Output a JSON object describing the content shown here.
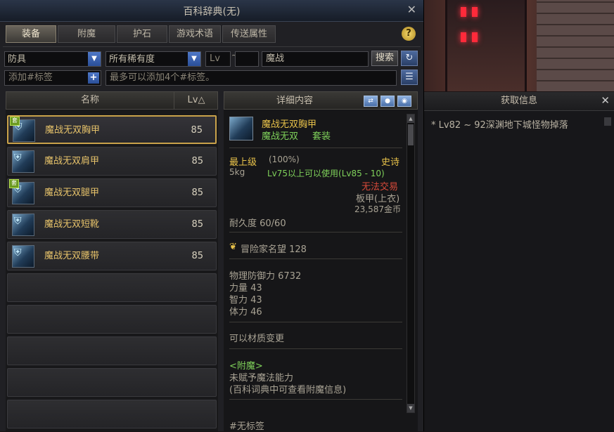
{
  "window": {
    "title": "百科辞典(无)",
    "close": "✕"
  },
  "tabs": [
    {
      "label": "装备",
      "active": true
    },
    {
      "label": "附魔",
      "active": false
    },
    {
      "label": "护石",
      "active": false
    },
    {
      "label": "游戏术语",
      "active": false
    },
    {
      "label": "传送属性",
      "active": false
    }
  ],
  "help": "?",
  "filters": {
    "category": "防具",
    "rarity": "所有稀有度",
    "lv_label": "Lv",
    "lv_sep": "~",
    "lv_min": "",
    "lv_max": "",
    "search_value": "魔战",
    "search_button": "搜索",
    "refresh_icon": "↻",
    "tag_placeholder": "添加#标签",
    "tag_add": "+",
    "tag_hint": "最多可以添加4个#标签。",
    "sort_icon": "☰"
  },
  "list": {
    "col_name": "名称",
    "col_lv": "Lv△",
    "items": [
      {
        "name": "魔战无双胸甲",
        "lv": "85",
        "selected": true
      },
      {
        "name": "魔战无双肩甲",
        "lv": "85",
        "selected": false
      },
      {
        "name": "魔战无双腿甲",
        "lv": "85",
        "selected": false
      },
      {
        "name": "魔战无双短靴",
        "lv": "85",
        "selected": false
      },
      {
        "name": "魔战无双腰带",
        "lv": "85",
        "selected": false
      }
    ]
  },
  "detail": {
    "title": "详细内容",
    "item_name": "魔战无双胸甲",
    "set_name": "魔战无双",
    "set_label": "套装",
    "grade": "最上级",
    "grade_pct": "(100%)",
    "rarity": "史诗",
    "weight": "5kg",
    "requirement": "Lv75以上可以使用(Lv85 - 10)",
    "trade": "无法交易",
    "type": "板甲(上衣)",
    "price": "23,587金币",
    "durability": "耐久度 60/60",
    "fame": "冒险家名望 128",
    "stats": [
      "物理防御力 6732",
      "力量 43",
      "智力 43",
      "体力 46"
    ],
    "material_change": "可以材质变更",
    "enchant_header": "<附魔>",
    "enchant_text": "未赋予魔法能力",
    "enchant_hint": "(百科词典中可查看附魔信息)",
    "tag": "#无标签"
  },
  "info": {
    "title": "获取信息",
    "close": "✕",
    "source": "* Lv82 ~ 92深渊地下城怪物掉落"
  },
  "colors": {
    "gold": "#e8c24a",
    "green": "#7fd15a",
    "red": "#d84a3a",
    "selected_border": "#c9a24a"
  }
}
